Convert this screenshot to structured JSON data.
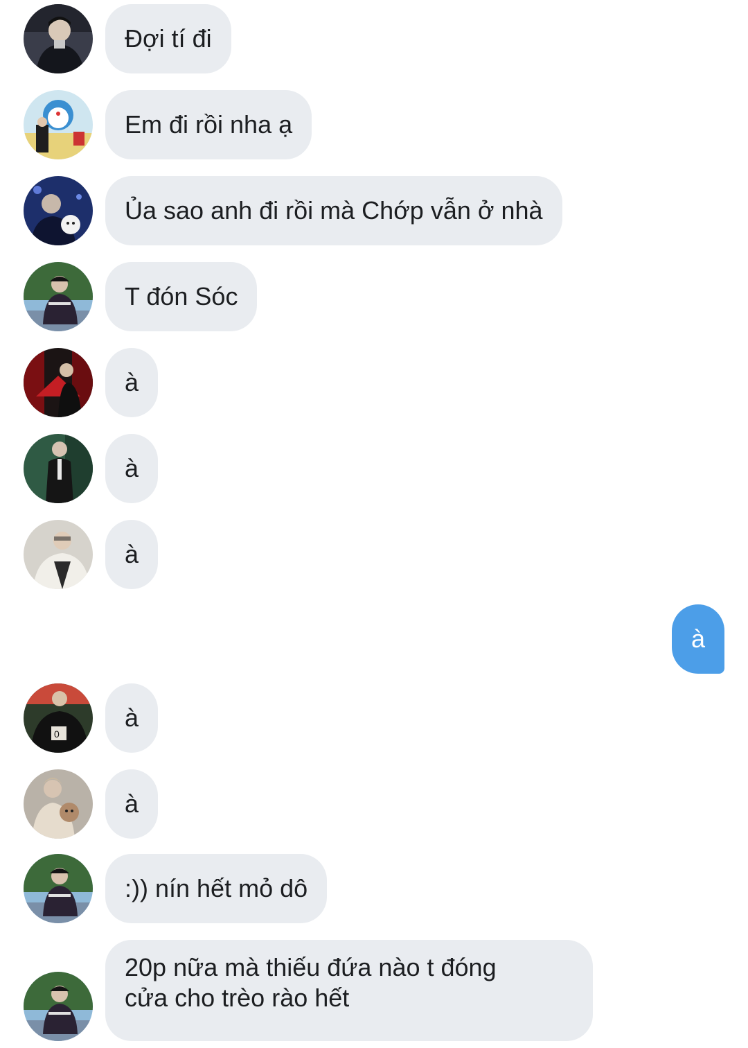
{
  "chat": {
    "accent_color": "#4c9ee8",
    "incoming_bubble_color": "#e9ecf0",
    "messages": [
      {
        "sender": "other",
        "text": "Đợi tí đi",
        "avatar_colors": [
          "#3a3d4a",
          "#d9c9b8"
        ]
      },
      {
        "sender": "other",
        "text": "Em đi rồi nha ạ",
        "avatar_colors": [
          "#8fc7e0",
          "#e7d27a"
        ]
      },
      {
        "sender": "other",
        "text": "Ủa sao anh đi rồi mà Chớp vẫn ở nhà",
        "avatar_colors": [
          "#1d2f6b",
          "#f2f2f2"
        ]
      },
      {
        "sender": "other",
        "text": "T đón Sóc",
        "avatar_colors": [
          "#3d6a3a",
          "#2a2233"
        ]
      },
      {
        "sender": "other",
        "text": "à",
        "avatar_colors": [
          "#7a0f12",
          "#1b1414"
        ]
      },
      {
        "sender": "other",
        "text": "à",
        "avatar_colors": [
          "#2f5a44",
          "#151515"
        ]
      },
      {
        "sender": "other",
        "text": "à",
        "avatar_colors": [
          "#d6d3cc",
          "#2a2a2a"
        ]
      },
      {
        "sender": "self",
        "text": "à"
      },
      {
        "sender": "other",
        "text": "à",
        "avatar_colors": [
          "#2d3b2a",
          "#c94a3a"
        ]
      },
      {
        "sender": "other",
        "text": "à",
        "avatar_colors": [
          "#b9b2a8",
          "#e6dccd"
        ]
      },
      {
        "sender": "other",
        "text": ":)) nín hết mỏ dô",
        "avatar_colors": [
          "#3d6a3a",
          "#2a2233"
        ]
      },
      {
        "sender": "other",
        "text_lines": [
          "20p nữa mà thiếu đứa nào t đóng",
          "cửa cho trèo rào hết"
        ],
        "avatar_colors": [
          "#3d6a3a",
          "#2a2233"
        ]
      }
    ]
  }
}
